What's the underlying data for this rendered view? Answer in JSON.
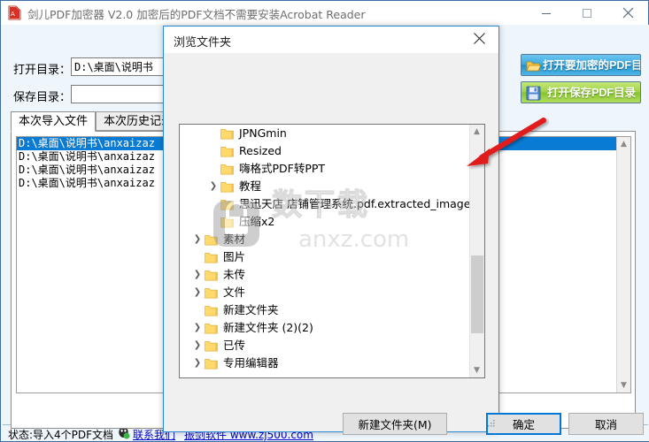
{
  "window": {
    "title": "剑儿PDF加密器  V2.0 加密后的PDF文档不需要安装Acrobat Reader",
    "icon": "app-pdf-icon",
    "controls": {
      "minimize": "minimize-icon",
      "maximize": "maximize-icon",
      "close": "close-icon"
    }
  },
  "form": {
    "open_dir_label": "打开目录：",
    "open_dir_value": "D:\\桌面\\说明书",
    "save_dir_label": "保存目录：",
    "save_dir_value": "",
    "save_dir_placeholder": ""
  },
  "actions": {
    "open_pdf_label": "打开要加密的PDF目录",
    "open_pdf_icon": "open-folder-icon",
    "save_pdf_label": "打开保存PDF目录",
    "save_pdf_icon": "floppy-save-icon"
  },
  "tabs": [
    {
      "label": "本次导入文件",
      "selected": true
    },
    {
      "label": "本次历史记录",
      "selected": false
    }
  ],
  "file_list": [
    {
      "text": "D:\\桌面\\说明书\\anxaizaz",
      "selected": true
    },
    {
      "text": "D:\\桌面\\说明书\\anxaizaz",
      "selected": false
    },
    {
      "text": "D:\\桌面\\说明书\\anxaizaz",
      "selected": false
    },
    {
      "text": "D:\\桌面\\说明书\\anxaizaz",
      "selected": false
    }
  ],
  "status": {
    "text": "状态:导入4个PDF文档",
    "contact_icon": "contact-qq-icon",
    "contact_label": "联系我们",
    "vendor_label": "振剑软件 www.zj500.com"
  },
  "dialog": {
    "title": "浏览文件夹",
    "close_icon": "close-icon",
    "tree": [
      {
        "label": "JPNGmin",
        "indent": 2,
        "expander": false
      },
      {
        "label": "Resized",
        "indent": 2,
        "expander": false
      },
      {
        "label": "嗨格式PDF转PPT",
        "indent": 2,
        "expander": false
      },
      {
        "label": "教程",
        "indent": 2,
        "expander": true
      },
      {
        "label": "思迅天店 店铺管理系统.pdf.extracted_images",
        "indent": 2,
        "expander": false
      },
      {
        "label": "压缩x2",
        "indent": 2,
        "expander": false
      },
      {
        "label": "素材",
        "indent": 1,
        "expander": true
      },
      {
        "label": "图片",
        "indent": 1,
        "expander": false
      },
      {
        "label": "未传",
        "indent": 1,
        "expander": true
      },
      {
        "label": "文件",
        "indent": 1,
        "expander": true
      },
      {
        "label": "新建文件夹",
        "indent": 1,
        "expander": false
      },
      {
        "label": "新建文件夹 (2)(2)",
        "indent": 1,
        "expander": true
      },
      {
        "label": "已传",
        "indent": 1,
        "expander": true
      },
      {
        "label": "专用编辑器",
        "indent": 1,
        "expander": true
      }
    ],
    "buttons": {
      "new_folder": "新建文件夹(M)",
      "ok": "确定",
      "cancel": "取消"
    }
  },
  "watermark": {
    "text": "anxz.com",
    "icon": "lock-watermark-icon"
  },
  "annotation": {
    "arrow": "red-arrow-pointing-to-scrollbar",
    "color": "#e01b1b"
  },
  "colors": {
    "accent_blue": "#0078d7",
    "selection_blue": "#0a7bd4",
    "button_blue": "#1e90d0",
    "button_green": "#86c52b",
    "link": "#0000cd",
    "folder_yellow": "#ffd96b"
  }
}
